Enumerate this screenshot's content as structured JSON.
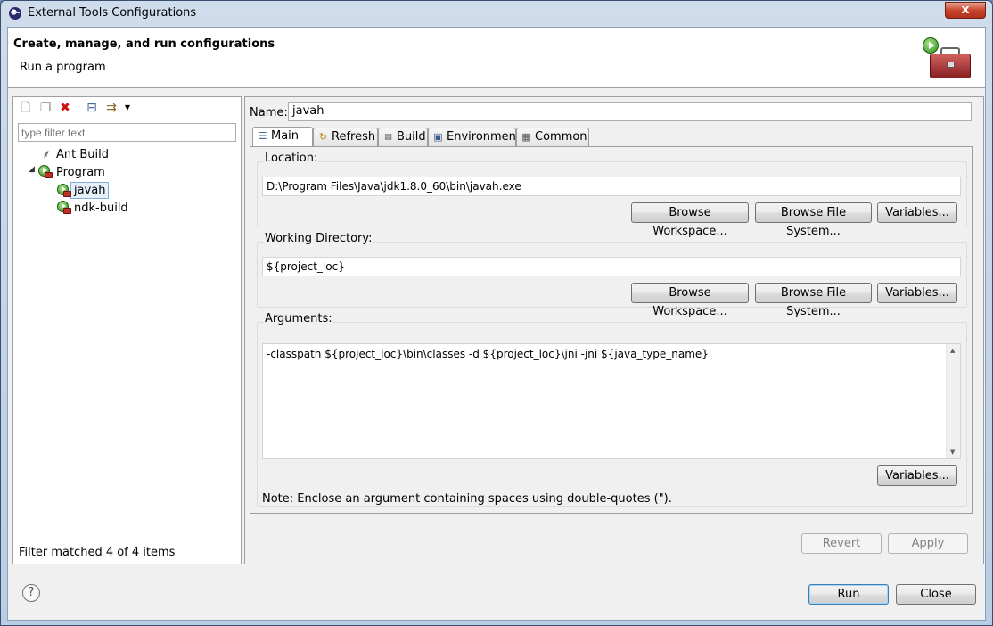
{
  "window": {
    "title": "External Tools Configurations",
    "close_glyph": "x"
  },
  "header": {
    "title": "Create, manage, and run configurations",
    "subtitle": "Run a program"
  },
  "left_panel": {
    "filter": {
      "value": "",
      "placeholder": "type filter text"
    },
    "tree": [
      {
        "label": "Ant Build",
        "level": 0,
        "kind": "ant"
      },
      {
        "label": "Program",
        "level": 0,
        "kind": "program",
        "expanded": true
      },
      {
        "label": "javah",
        "level": 1,
        "kind": "program",
        "selected": true
      },
      {
        "label": "ndk-build",
        "level": 1,
        "kind": "program"
      }
    ],
    "status": "Filter matched 4 of 4 items"
  },
  "right_panel": {
    "name_label": "Name:",
    "name_value": "javah",
    "tabs": [
      {
        "label": "Main",
        "active": true
      },
      {
        "label": "Refresh"
      },
      {
        "label": "Build"
      },
      {
        "label": "Environment"
      },
      {
        "label": "Common"
      }
    ],
    "location": {
      "label": "Location:",
      "value": "D:\\Program Files\\Java\\jdk1.8.0_60\\bin\\javah.exe",
      "browse_workspace": "Browse Workspace...",
      "browse_file_system": "Browse File System...",
      "variables": "Variables..."
    },
    "working_directory": {
      "label": "Working Directory:",
      "value": "${project_loc}",
      "browse_workspace": "Browse Workspace...",
      "browse_file_system": "Browse File System...",
      "variables": "Variables..."
    },
    "arguments": {
      "label": "Arguments:",
      "value": "-classpath ${project_loc}\\bin\\classes -d ${project_loc}\\jni -jni ${java_type_name}",
      "variables": "Variables...",
      "note": "Note: Enclose an argument containing spaces using double-quotes (\")."
    },
    "revert": "Revert",
    "apply": "Apply"
  },
  "footer": {
    "help_glyph": "?",
    "run": "Run",
    "close": "Close"
  }
}
